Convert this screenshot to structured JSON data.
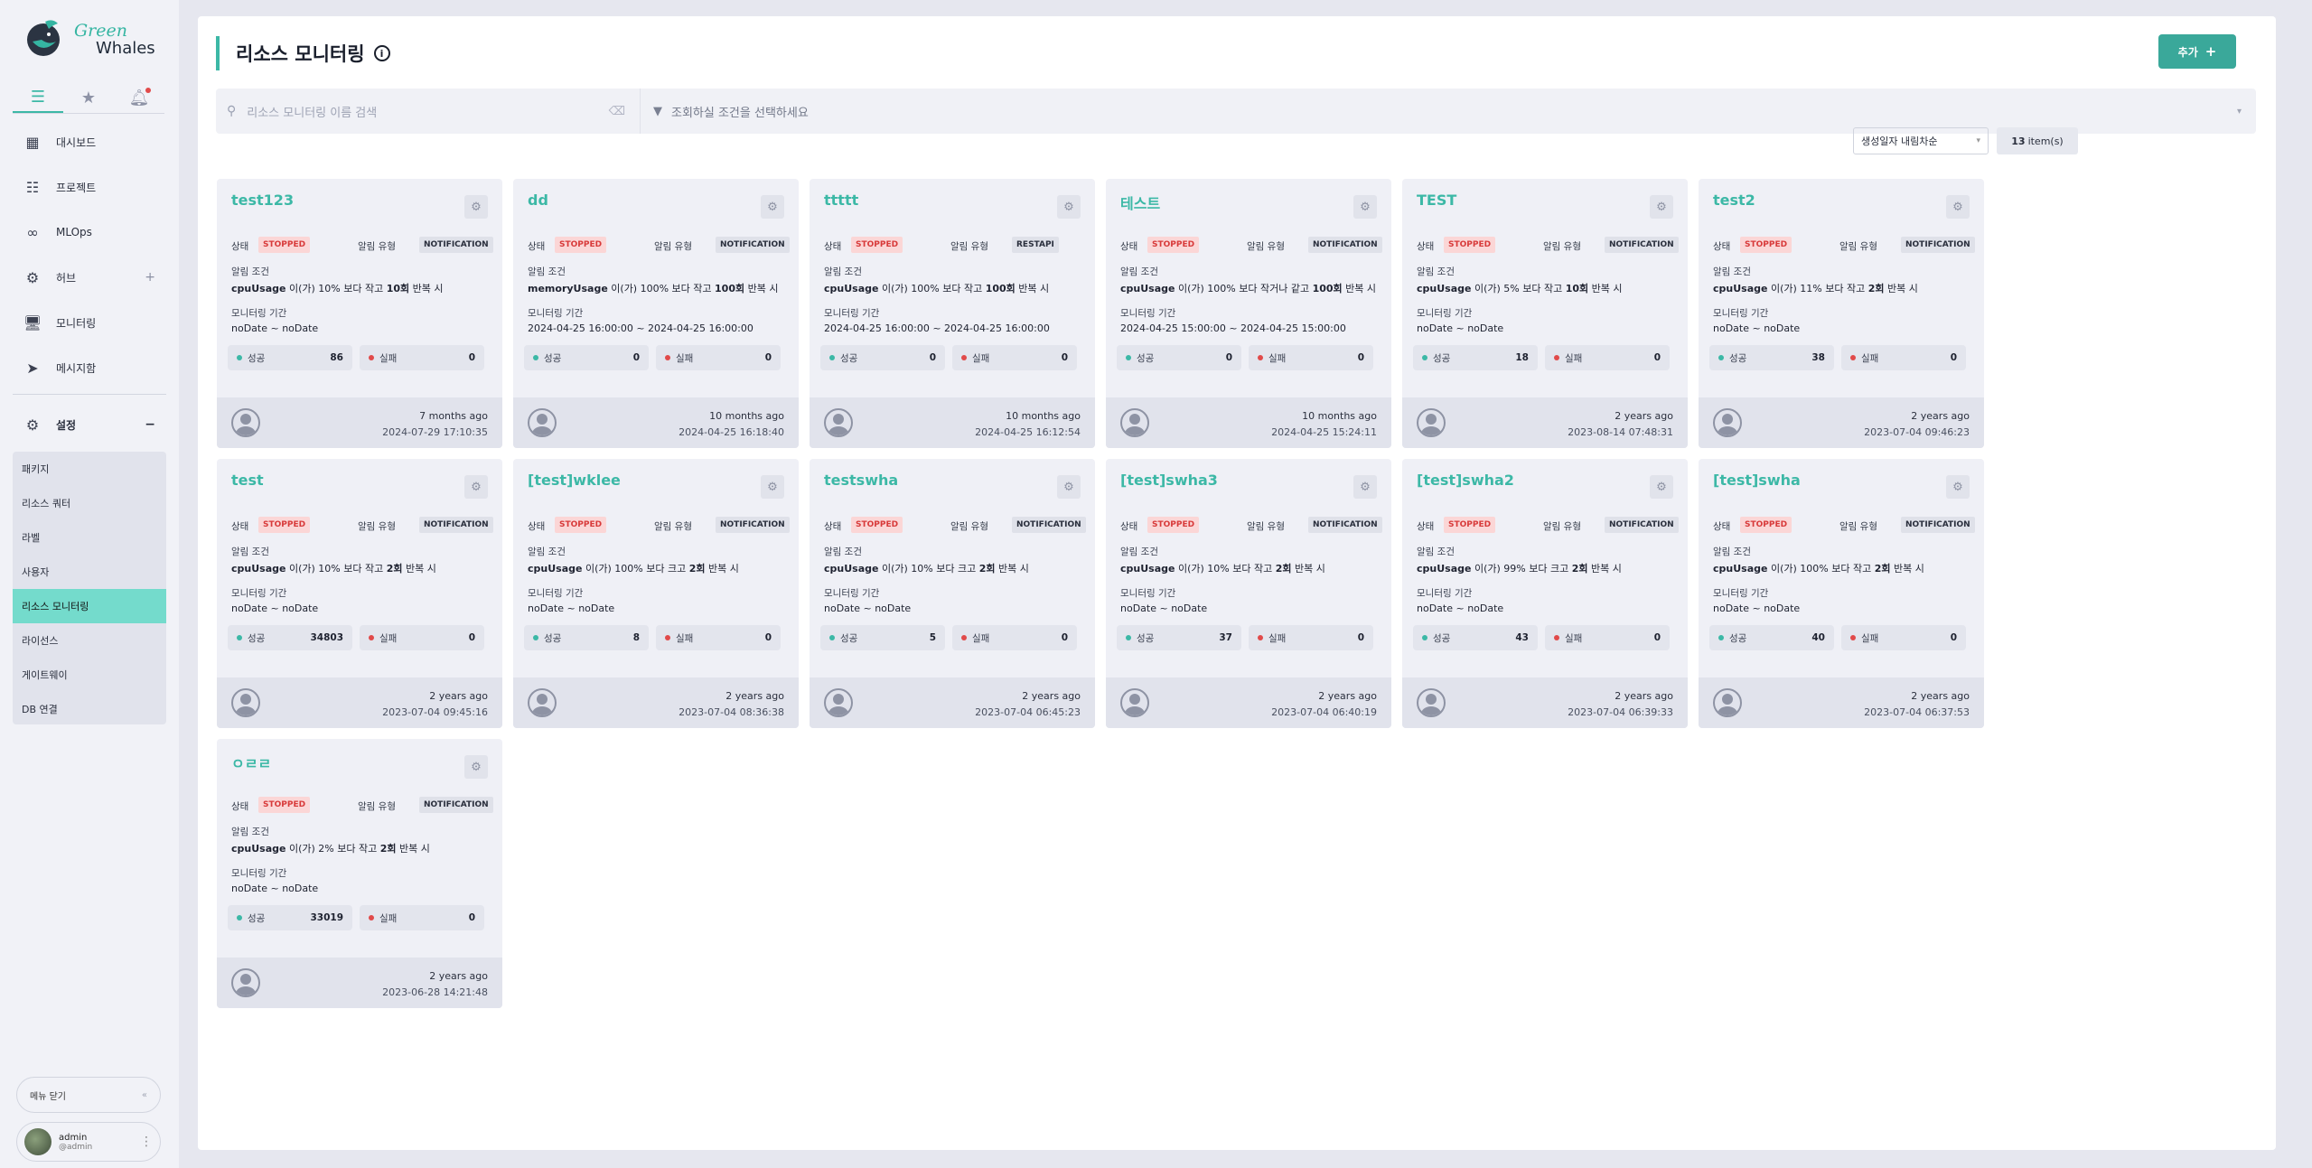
{
  "app": {
    "logo_line1": "Green",
    "logo_line2": "Whales"
  },
  "sidebar": {
    "items": [
      {
        "label": "대시보드",
        "icon": "dashboard-icon"
      },
      {
        "label": "프로젝트",
        "icon": "list-icon"
      },
      {
        "label": "MLOps",
        "icon": "infinity-icon"
      },
      {
        "label": "허브",
        "icon": "hub-icon"
      },
      {
        "label": "모니터링",
        "icon": "monitor-icon"
      },
      {
        "label": "메시지함",
        "icon": "send-icon"
      },
      {
        "label": "설정",
        "icon": "gear-icon"
      }
    ],
    "submenu": [
      "패키지",
      "리소스 쿼터",
      "라벨",
      "사용자",
      "리소스 모니터링",
      "라이선스",
      "게이트웨이",
      "DB 연결"
    ],
    "collapse_label": "메뉴 닫기",
    "user": {
      "name": "admin",
      "handle": "@admin"
    }
  },
  "header": {
    "title": "리소스 모니터링",
    "add_label": "추가"
  },
  "filters": {
    "search_placeholder": "리소스 모니터링 이름 검색",
    "condition_placeholder": "조회하실 조건을 선택하세요",
    "sort_value": "생성일자 내림차순",
    "count_num": "13",
    "count_suffix": "item(s)"
  },
  "labels": {
    "status": "상태",
    "alert_type": "알림 유형",
    "alert_cond": "알림 조건",
    "period": "모니터링 기간",
    "success": "성공",
    "fail": "실패"
  },
  "colors": {
    "accent": "#3cb8a6",
    "stopped_bg": "#fbd6d6",
    "stopped_fg": "#d83a3a",
    "success_dot": "#3cb8a6",
    "fail_dot": "#e14a4a"
  },
  "cards": [
    {
      "name": "test123",
      "status": "STOPPED",
      "type": "NOTIFICATION",
      "metric": "cpuUsage",
      "cond_mid": " 이(가) 10% 보다 작고 ",
      "repeat": "10회",
      "repeat_suffix": " 반복 시",
      "period": "noDate ~ noDate",
      "success": "86",
      "fail": "0",
      "rel": "7 months ago",
      "date": "2024-07-29 17:10:35"
    },
    {
      "name": "dd",
      "status": "STOPPED",
      "type": "NOTIFICATION",
      "metric": "memoryUsage",
      "cond_mid": " 이(가) 100% 보다 작고 ",
      "repeat": "100회",
      "repeat_suffix": " 반복 시",
      "period": "2024-04-25 16:00:00 ~ 2024-04-25 16:00:00",
      "success": "0",
      "fail": "0",
      "rel": "10 months ago",
      "date": "2024-04-25 16:18:40"
    },
    {
      "name": "ttttt",
      "status": "STOPPED",
      "type": "RESTAPI",
      "metric": "cpuUsage",
      "cond_mid": " 이(가) 100% 보다 작고 ",
      "repeat": "100회",
      "repeat_suffix": " 반복 시",
      "period": "2024-04-25 16:00:00 ~ 2024-04-25 16:00:00",
      "success": "0",
      "fail": "0",
      "rel": "10 months ago",
      "date": "2024-04-25 16:12:54"
    },
    {
      "name": "테스트",
      "status": "STOPPED",
      "type": "NOTIFICATION",
      "metric": "cpuUsage",
      "cond_mid": " 이(가) 100% 보다 작거나 같고 ",
      "repeat": "100회",
      "repeat_suffix": " 반복 시",
      "period": "2024-04-25 15:00:00 ~ 2024-04-25 15:00:00",
      "success": "0",
      "fail": "0",
      "rel": "10 months ago",
      "date": "2024-04-25 15:24:11"
    },
    {
      "name": "TEST",
      "status": "STOPPED",
      "type": "NOTIFICATION",
      "metric": "cpuUsage",
      "cond_mid": " 이(가) 5% 보다 작고 ",
      "repeat": "10회",
      "repeat_suffix": " 반복 시",
      "period": "noDate ~ noDate",
      "success": "18",
      "fail": "0",
      "rel": "2 years ago",
      "date": "2023-08-14 07:48:31"
    },
    {
      "name": "test2",
      "status": "STOPPED",
      "type": "NOTIFICATION",
      "metric": "cpuUsage",
      "cond_mid": " 이(가) 11% 보다 작고 ",
      "repeat": "2회",
      "repeat_suffix": " 반복 시",
      "period": "noDate ~ noDate",
      "success": "38",
      "fail": "0",
      "rel": "2 years ago",
      "date": "2023-07-04 09:46:23"
    },
    {
      "name": "test",
      "status": "STOPPED",
      "type": "NOTIFICATION",
      "metric": "cpuUsage",
      "cond_mid": " 이(가) 10% 보다 작고 ",
      "repeat": "2회",
      "repeat_suffix": " 반복 시",
      "period": "noDate ~ noDate",
      "success": "34803",
      "fail": "0",
      "rel": "2 years ago",
      "date": "2023-07-04 09:45:16"
    },
    {
      "name": "[test]wklee",
      "status": "STOPPED",
      "type": "NOTIFICATION",
      "metric": "cpuUsage",
      "cond_mid": " 이(가) 100% 보다 크고 ",
      "repeat": "2회",
      "repeat_suffix": " 반복 시",
      "period": "noDate ~ noDate",
      "success": "8",
      "fail": "0",
      "rel": "2 years ago",
      "date": "2023-07-04 08:36:38"
    },
    {
      "name": "testswha",
      "status": "STOPPED",
      "type": "NOTIFICATION",
      "metric": "cpuUsage",
      "cond_mid": " 이(가) 10% 보다 크고 ",
      "repeat": "2회",
      "repeat_suffix": " 반복 시",
      "period": "noDate ~ noDate",
      "success": "5",
      "fail": "0",
      "rel": "2 years ago",
      "date": "2023-07-04 06:45:23"
    },
    {
      "name": "[test]swha3",
      "status": "STOPPED",
      "type": "NOTIFICATION",
      "metric": "cpuUsage",
      "cond_mid": " 이(가) 10% 보다 작고 ",
      "repeat": "2회",
      "repeat_suffix": " 반복 시",
      "period": "noDate ~ noDate",
      "success": "37",
      "fail": "0",
      "rel": "2 years ago",
      "date": "2023-07-04 06:40:19"
    },
    {
      "name": "[test]swha2",
      "status": "STOPPED",
      "type": "NOTIFICATION",
      "metric": "cpuUsage",
      "cond_mid": " 이(가) 99% 보다 크고 ",
      "repeat": "2회",
      "repeat_suffix": " 반복 시",
      "period": "noDate ~ noDate",
      "success": "43",
      "fail": "0",
      "rel": "2 years ago",
      "date": "2023-07-04 06:39:33"
    },
    {
      "name": "[test]swha",
      "status": "STOPPED",
      "type": "NOTIFICATION",
      "metric": "cpuUsage",
      "cond_mid": " 이(가) 100% 보다 작고 ",
      "repeat": "2회",
      "repeat_suffix": " 반복 시",
      "period": "noDate ~ noDate",
      "success": "40",
      "fail": "0",
      "rel": "2 years ago",
      "date": "2023-07-04 06:37:53"
    },
    {
      "name": "ㅇㄹㄹ",
      "status": "STOPPED",
      "type": "NOTIFICATION",
      "metric": "cpuUsage",
      "cond_mid": " 이(가) 2% 보다 작고 ",
      "repeat": "2회",
      "repeat_suffix": " 반복 시",
      "period": "noDate ~ noDate",
      "success": "33019",
      "fail": "0",
      "rel": "2 years ago",
      "date": "2023-06-28 14:21:48"
    }
  ]
}
